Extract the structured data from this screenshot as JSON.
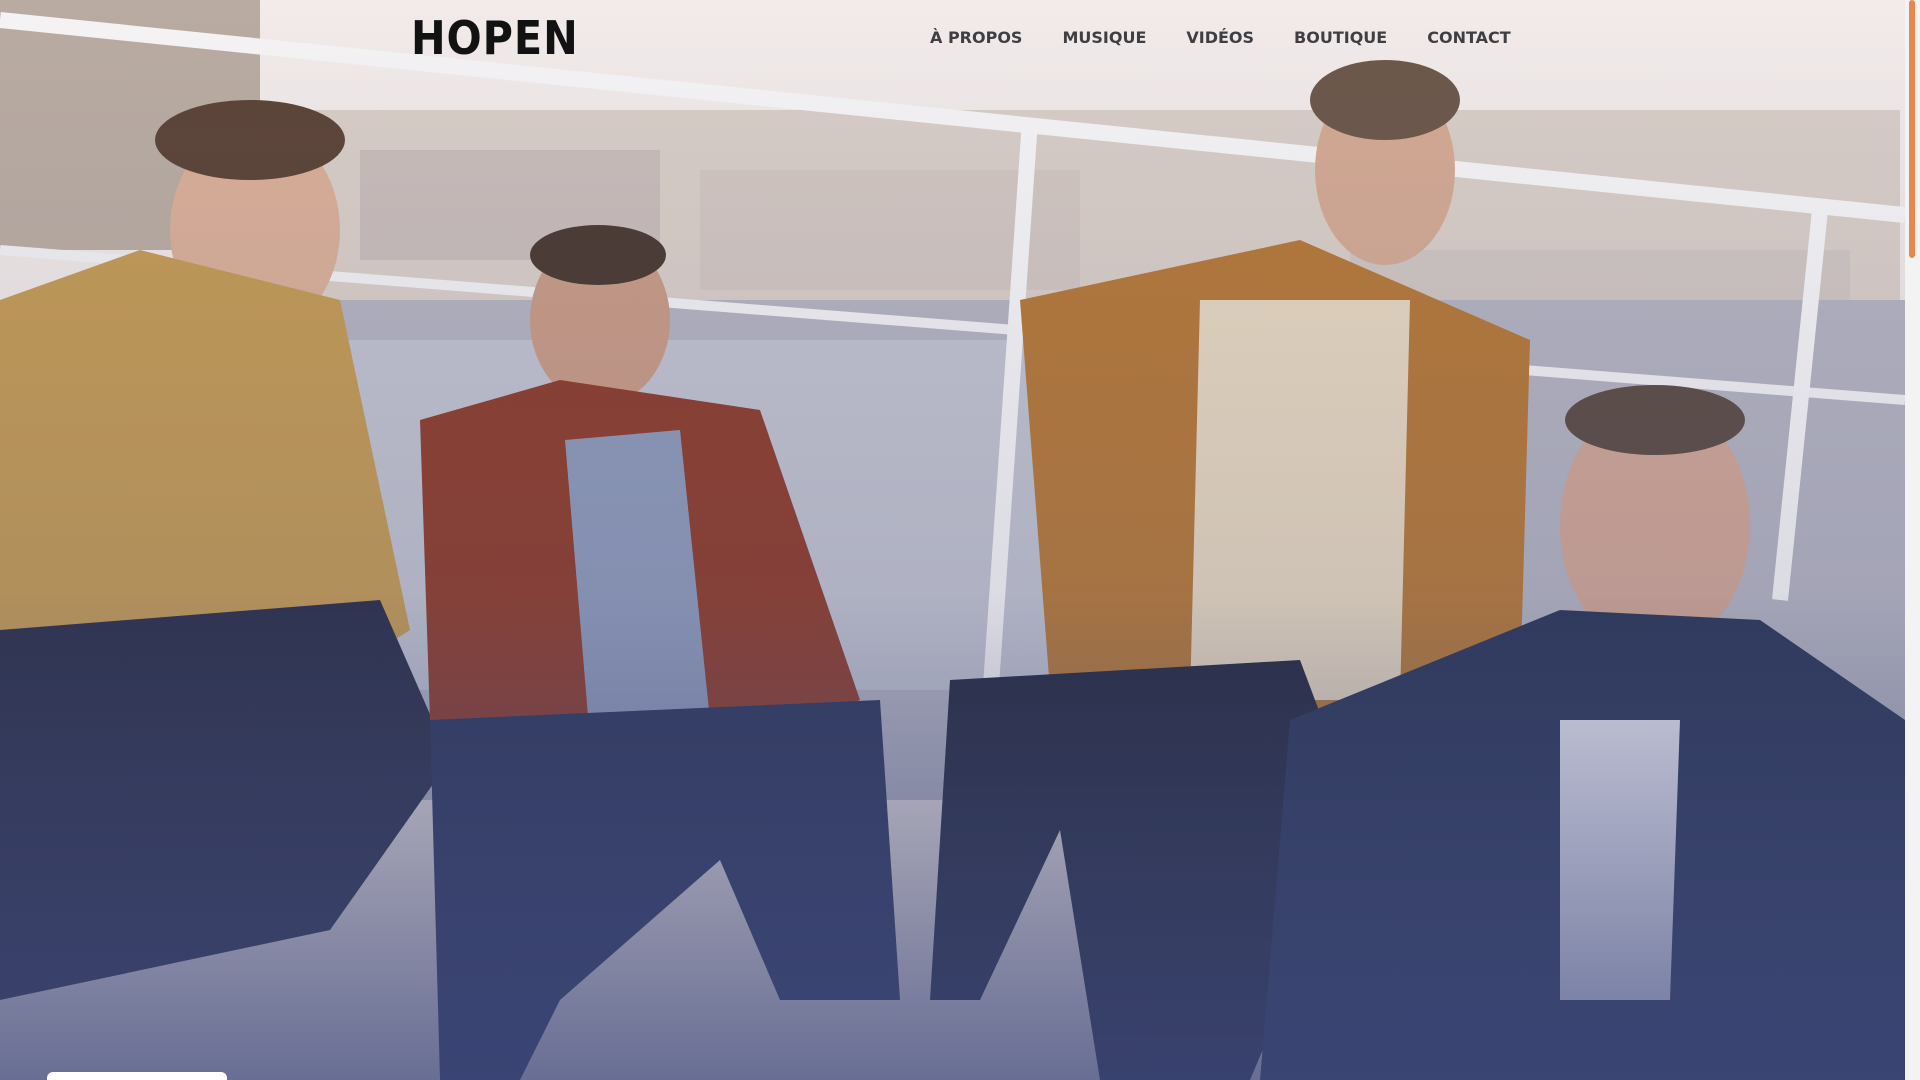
{
  "header": {
    "logo_text": "HOPEN",
    "nav": [
      {
        "label": "À PROPOS"
      },
      {
        "label": "MUSIQUE"
      },
      {
        "label": "VIDÉOS"
      },
      {
        "label": "BOUTIQUE"
      },
      {
        "label": "CONTACT"
      }
    ]
  },
  "hero": {
    "photo": "band-photo"
  },
  "colors": {
    "accent": "#e8884f",
    "nav_text": "#3e3e43",
    "logo": "#121212"
  }
}
